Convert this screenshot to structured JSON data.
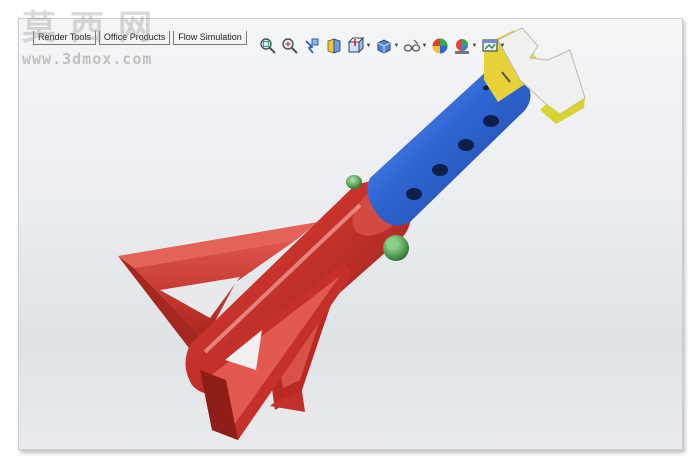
{
  "watermark": {
    "logo_text": "莫西网",
    "url": "www.3dmox.com"
  },
  "tabs": [
    {
      "label": "Render Tools"
    },
    {
      "label": "Office Products"
    },
    {
      "label": "Flow Simulation"
    }
  ],
  "toolbar": {
    "tools": [
      {
        "icon": "zoom-to-fit-icon"
      },
      {
        "icon": "zoom-to-area-icon"
      },
      {
        "icon": "previous-view-icon"
      },
      {
        "icon": "section-view-icon"
      },
      {
        "icon": "view-orientation-icon"
      },
      {
        "icon": "display-style-icon"
      },
      {
        "icon": "hide-show-items-icon"
      },
      {
        "icon": "edit-appearance-icon"
      },
      {
        "icon": "apply-scene-icon"
      },
      {
        "icon": "view-settings-icon"
      }
    ]
  },
  "colors": {
    "base_red": "#c8332c",
    "tube_blue": "#2f66d4",
    "cap_yellow": "#e8d23a",
    "cap_white": "#f0f0ee",
    "knob_green": "#5aa65a",
    "viewport_bg": "#eceef1"
  }
}
